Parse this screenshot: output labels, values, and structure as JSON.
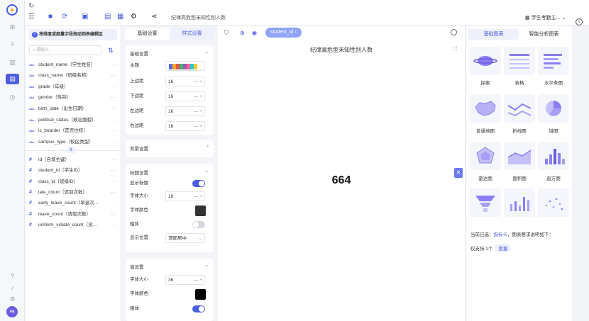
{
  "toolbar": {
    "report_title": "纪律高危型未知性别人数",
    "dataset_label": "学生考勤主..."
  },
  "fields_panel": {
    "hint": "将维度或度量字段拖动到表编辑区",
    "search_placeholder": "请输入",
    "dimensions": [
      {
        "type": "Abc",
        "name": "student_name（学生姓名）"
      },
      {
        "type": "Abc",
        "name": "class_name（班级名称）"
      },
      {
        "type": "Abc",
        "name": "grade（年级）"
      },
      {
        "type": "Abc",
        "name": "gender（性别）"
      },
      {
        "type": "Abc",
        "name": "birth_date（出生日期）"
      },
      {
        "type": "Abc",
        "name": "political_status（政治面貌）"
      },
      {
        "type": "Abc",
        "name": "is_boarder（是否住校）"
      },
      {
        "type": "Abc",
        "name": "campus_type（校区类型）"
      }
    ],
    "measures": [
      {
        "type": "#",
        "name": "id（自增主键）"
      },
      {
        "type": "#",
        "name": "student_id（学生ID）"
      },
      {
        "type": "#",
        "name": "class_id（班级ID）"
      },
      {
        "type": "#",
        "name": "late_count（迟到次数）"
      },
      {
        "type": "#",
        "name": "early_leave_count（早退次..."
      },
      {
        "type": "#",
        "name": "leave_count（请假次数）"
      },
      {
        "type": "#",
        "name": "uniform_violate_count（没..."
      }
    ]
  },
  "style_panel": {
    "tabs": [
      "基础设置",
      "样式设置"
    ],
    "basic": {
      "header": "基础设置",
      "theme_label": "主题",
      "palette": [
        "#5b6ee1",
        "#f5a623",
        "#e8534a",
        "#3cb371",
        "#9b59b6",
        "#f06292",
        "#26c6da",
        "#ffca28"
      ],
      "margins": [
        {
          "label": "上边距",
          "value": "16"
        },
        {
          "label": "下边距",
          "value": "16"
        },
        {
          "label": "左边距",
          "value": "16"
        },
        {
          "label": "右边距",
          "value": "16"
        }
      ]
    },
    "background": {
      "header": "背景设置"
    },
    "title_settings": {
      "header": "标题设置",
      "show_title_label": "显示标题",
      "font_size_label": "字体大小",
      "font_size_value": "16",
      "font_color_label": "字体颜色",
      "font_color": "#333333",
      "bold_label": "粗体",
      "position_label": "显示位置",
      "position_value": "顶部居中"
    },
    "value_settings": {
      "header": "值设置",
      "font_size_label": "字体大小",
      "font_size_value": "36",
      "font_color_label": "字体颜色",
      "font_color": "#000000",
      "bold_label": "粗体"
    },
    "stepper_symbols": "— +"
  },
  "canvas": {
    "field_pill": "student_id ›",
    "chart_title": "纪律高危型未知性别人数",
    "value": "664"
  },
  "chart_panel": {
    "tabs": [
      "基础图表",
      "智能分析图表"
    ],
    "charts": [
      "探索",
      "表格",
      "水平条图",
      "普通地图",
      "折线图",
      "饼图",
      "雷达图",
      "面积图",
      "直方图"
    ],
    "current_prefix": "当前已选：",
    "current_value": "指标卡",
    "current_suffix": "，图表要求说明如下：",
    "support_prefix": "仅支持 1个",
    "support_tag": "度量"
  },
  "accent": "#4b5de0"
}
